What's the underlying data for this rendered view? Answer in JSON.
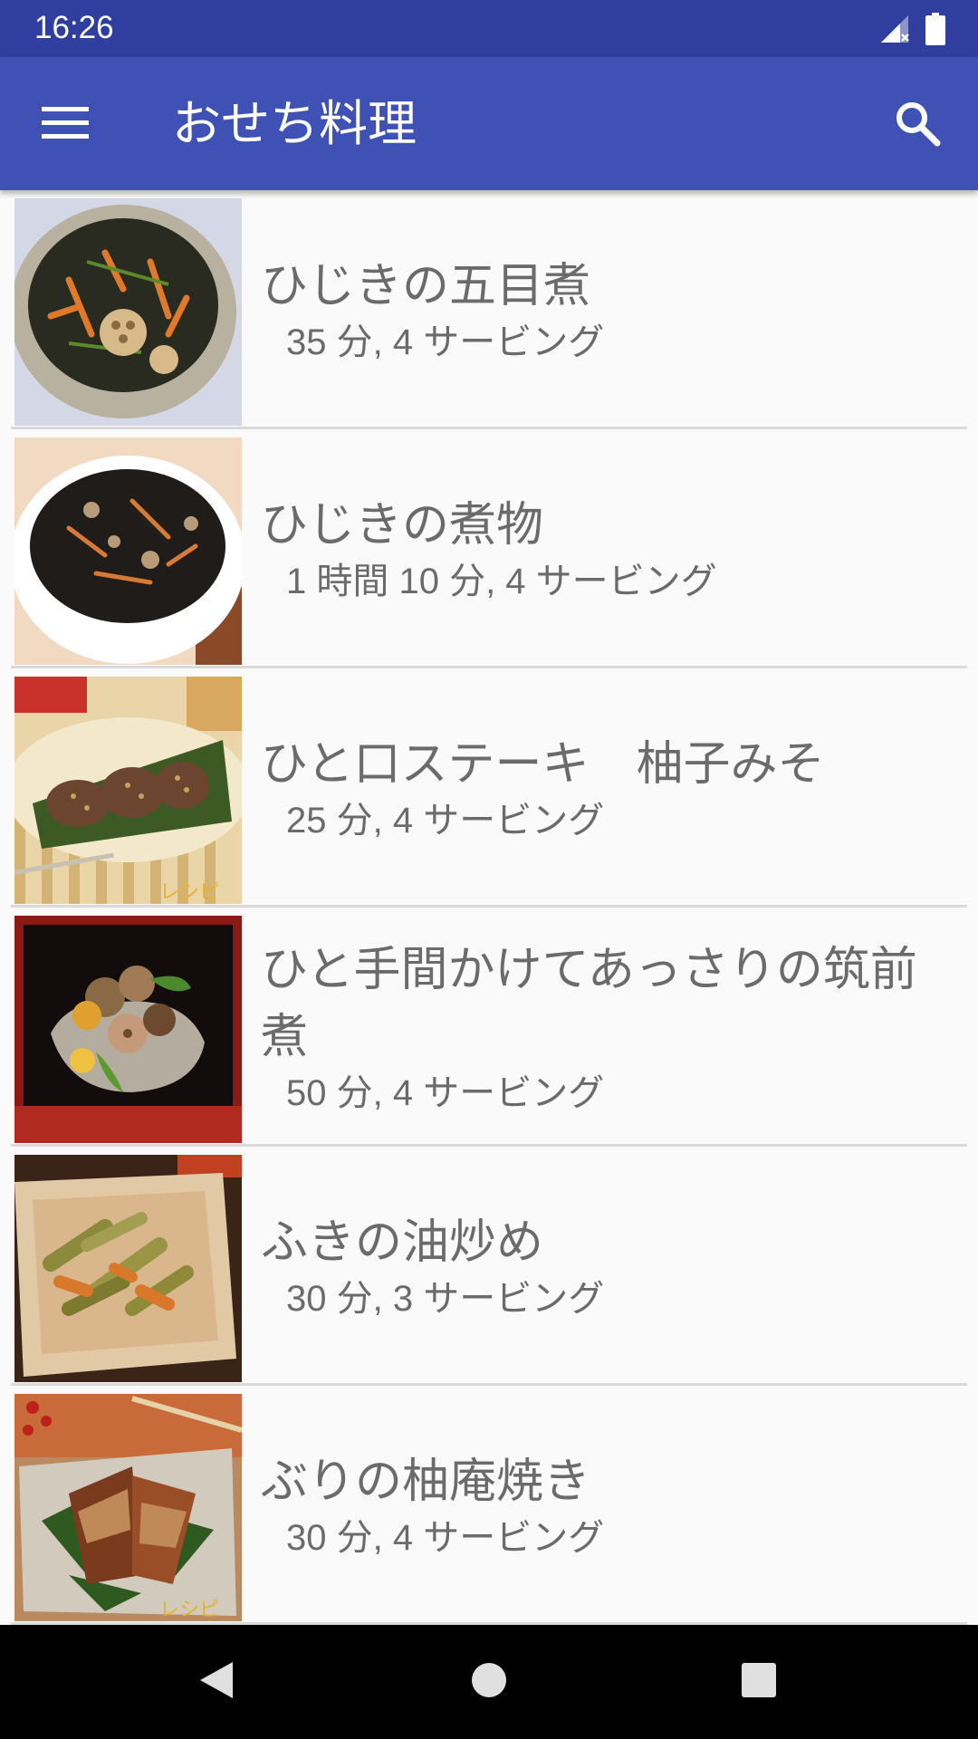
{
  "status_bar": {
    "time": "16:26",
    "icons": [
      "signal-icon",
      "battery-icon"
    ]
  },
  "app_bar": {
    "title": "おせち料理",
    "menu_icon": "hamburger-menu-icon",
    "search_icon": "search-icon",
    "color": "#3f51b5",
    "status_color": "#303f9f"
  },
  "recipes": [
    {
      "name": "ひじきの五目煮",
      "meta": "35 分, 4 サービング",
      "image": "hijiki-gomoku-photo"
    },
    {
      "name": "ひじきの煮物",
      "meta": "1 時間 10 分, 4 サービング",
      "image": "hijiki-nimono-photo"
    },
    {
      "name": "ひと口ステーキ　柚子みそ",
      "meta": "25 分, 4 サービング",
      "image": "hitokuchi-steak-photo"
    },
    {
      "name": "ひと手間かけてあっさりの筑前煮",
      "meta": "50 分, 4 サービング",
      "image": "chikuzenni-photo"
    },
    {
      "name": "ふきの油炒め",
      "meta": "30 分, 3 サービング",
      "image": "fuki-itame-photo"
    },
    {
      "name": "ぶりの柚庵焼き",
      "meta": "30 分, 4 サービング",
      "image": "buri-yuanyaki-photo"
    }
  ],
  "nav_bar": {
    "icons": [
      "back-icon",
      "home-icon",
      "recents-icon"
    ]
  }
}
